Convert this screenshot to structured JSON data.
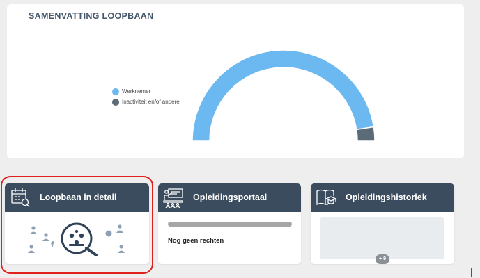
{
  "summary": {
    "title": "SAMENVATTING LOOPBAAN",
    "legend": [
      {
        "label": "Werknemer",
        "color": "#6cb8f0"
      },
      {
        "label": "Inactiviteit en/of andere",
        "color": "#5c6b78"
      }
    ]
  },
  "chart_data": {
    "type": "pie",
    "shape": "half-donut",
    "title": "",
    "series": [
      {
        "name": "Werknemer",
        "value": 95,
        "color": "#6cb8f0"
      },
      {
        "name": "Inactiviteit en/of andere",
        "value": 5,
        "color": "#5c6b78"
      }
    ],
    "legend_position": "left"
  },
  "tiles": [
    {
      "title": "Loopbaan in detail",
      "icon": "calendar-search-icon",
      "highlighted": true
    },
    {
      "title": "Opleidingsportaal",
      "icon": "classroom-icon",
      "status": "Nog geen rechten"
    },
    {
      "title": "Opleidingshistoriek",
      "icon": "book-graduation-icon",
      "badge": "+ 9"
    }
  ],
  "colors": {
    "header_bg": "#3b4c5f",
    "highlight": "#e0201d",
    "page_bg": "#eeeeee"
  }
}
